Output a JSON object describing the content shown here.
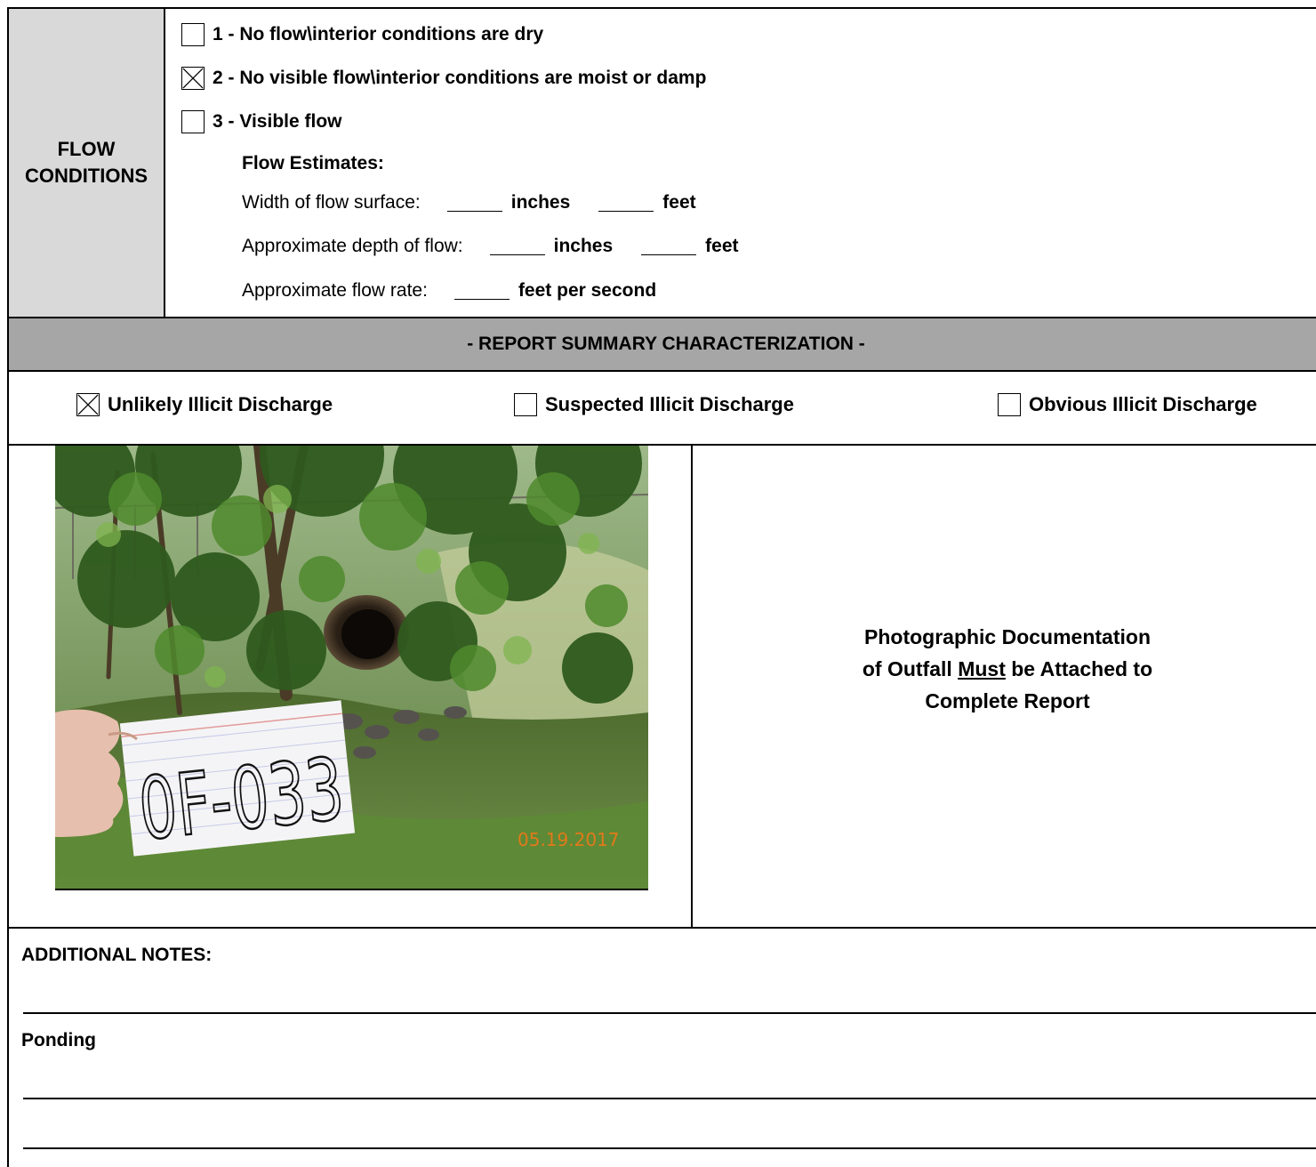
{
  "flow": {
    "label_line1": "FLOW",
    "label_line2": "CONDITIONS",
    "options": [
      {
        "label": "1 - No flow\\interior conditions are dry",
        "checked": false
      },
      {
        "label": "2 - No visible flow\\interior conditions are moist or damp",
        "checked": true
      },
      {
        "label": "3 - Visible flow",
        "checked": false
      }
    ],
    "estimates_title": "Flow Estimates:",
    "width_label": "Width of flow surface:",
    "depth_label": "Approximate depth of flow:",
    "rate_label": "Approximate flow rate:",
    "inches_unit": "inches",
    "feet_unit": "feet",
    "fps_unit": "feet per second"
  },
  "summary": {
    "title": "- REPORT SUMMARY CHARACTERIZATION -",
    "options": [
      {
        "label": "Unlikely Illicit Discharge",
        "checked": true
      },
      {
        "label": "Suspected Illicit Discharge",
        "checked": false
      },
      {
        "label": "Obvious Illicit Discharge",
        "checked": false
      }
    ]
  },
  "photo": {
    "card_text": "0F-033",
    "date_stamp": "05.19.2017"
  },
  "documentation": {
    "line1": "Photographic Documentation",
    "line2_pre": "of Outfall ",
    "line2_must": "Must",
    "line2_post": " be Attached to",
    "line3": "Complete Report"
  },
  "notes": {
    "title": "ADDITIONAL NOTES:",
    "entry": "Ponding"
  },
  "colors": {
    "label_bg": "#d9d9d9",
    "summary_bar_bg": "#a6a6a6",
    "date_stamp": "#e07a1a"
  }
}
